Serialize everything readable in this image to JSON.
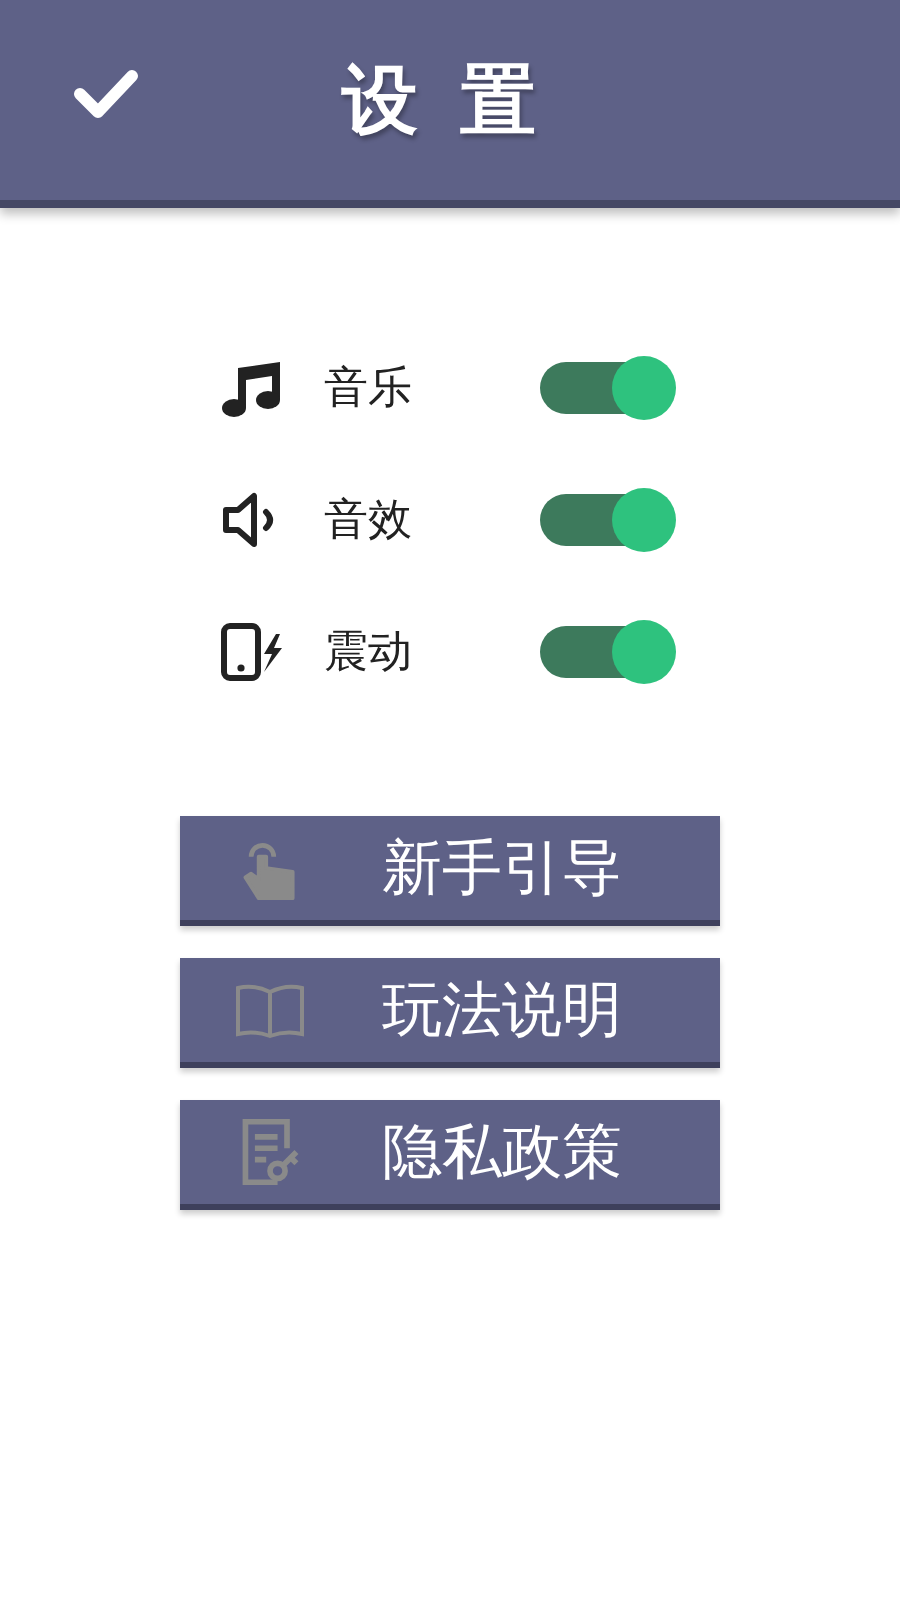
{
  "header": {
    "title": "设 置"
  },
  "settings": [
    {
      "kind": "music",
      "label": "音乐",
      "on": true
    },
    {
      "kind": "sound",
      "label": "音效",
      "on": true
    },
    {
      "kind": "vibrate",
      "label": "震动",
      "on": true
    }
  ],
  "buttons": [
    {
      "kind": "guide",
      "label": "新手引导"
    },
    {
      "kind": "rules",
      "label": "玩法说明"
    },
    {
      "kind": "privacy",
      "label": "隐私政策"
    }
  ]
}
